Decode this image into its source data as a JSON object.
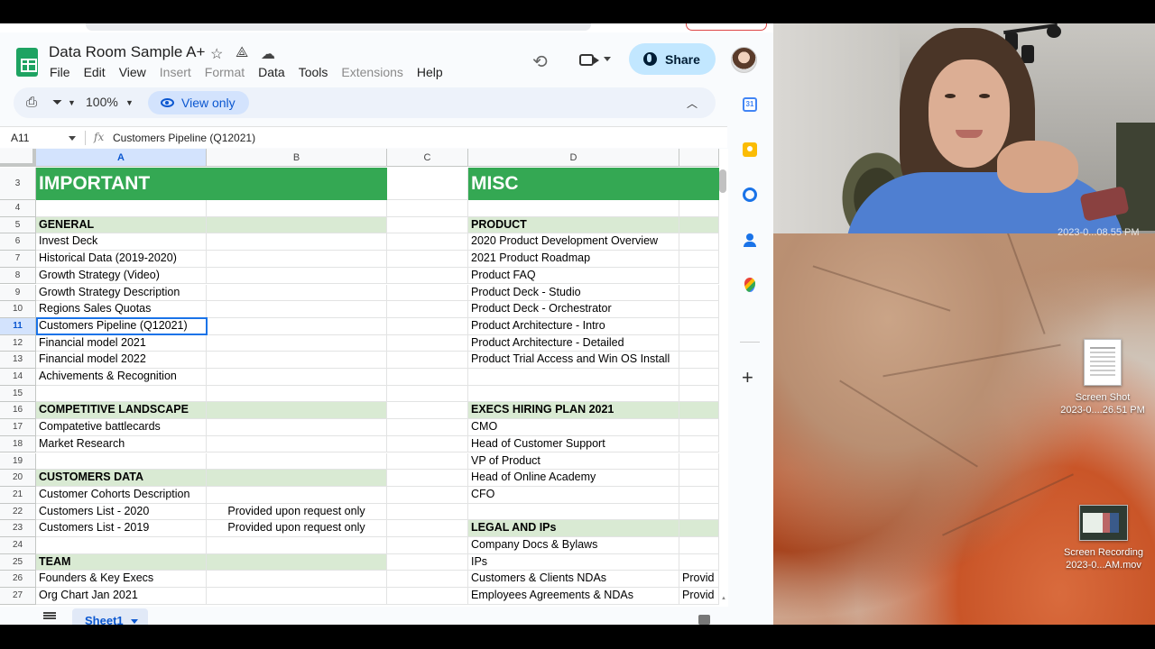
{
  "app": {
    "doc_title": "Data Room Sample A+",
    "menu": [
      {
        "label": "File",
        "enabled": true
      },
      {
        "label": "Edit",
        "enabled": true
      },
      {
        "label": "View",
        "enabled": true
      },
      {
        "label": "Insert",
        "enabled": false
      },
      {
        "label": "Format",
        "enabled": false
      },
      {
        "label": "Data",
        "enabled": true
      },
      {
        "label": "Tools",
        "enabled": true
      },
      {
        "label": "Extensions",
        "enabled": false
      },
      {
        "label": "Help",
        "enabled": true
      }
    ],
    "share_label": "Share"
  },
  "toolbar": {
    "zoom": "100%",
    "view_only_label": "View only"
  },
  "formula_bar": {
    "name_box": "A11",
    "fx": "fx",
    "value": "Customers Pipeline (Q12021)"
  },
  "grid": {
    "columns": [
      "A",
      "B",
      "C",
      "D",
      ""
    ],
    "selected_column": "A",
    "selected_row": "11",
    "rows": [
      {
        "num": "3",
        "a": "IMPORTANT",
        "b": "",
        "d": "MISC",
        "e": "",
        "style": "big"
      },
      {
        "num": "4",
        "a": "",
        "b": "",
        "d": "",
        "e": "",
        "style": ""
      },
      {
        "num": "5",
        "a": "GENERAL",
        "b": "",
        "d": "PRODUCT",
        "e": "",
        "style": "sec-both"
      },
      {
        "num": "6",
        "a": "Invest Deck",
        "b": "",
        "d": "2020 Product Development Overview",
        "e": "",
        "style": ""
      },
      {
        "num": "7",
        "a": "Historical Data (2019-2020)",
        "b": "",
        "d": "2021 Product Roadmap",
        "e": "",
        "style": ""
      },
      {
        "num": "8",
        "a": "Growth Strategy (Video)",
        "b": "",
        "d": "Product FAQ",
        "e": "",
        "style": ""
      },
      {
        "num": "9",
        "a": "Growth Strategy Description",
        "b": "",
        "d": "Product Deck - Studio",
        "e": "",
        "style": ""
      },
      {
        "num": "10",
        "a": "Regions Sales Quotas",
        "b": "",
        "d": "Product Deck - Orchestrator",
        "e": "",
        "style": ""
      },
      {
        "num": "11",
        "a": "Customers Pipeline (Q12021)",
        "b": "",
        "d": "Product Architecture - Intro",
        "e": "",
        "style": ""
      },
      {
        "num": "12",
        "a": "Financial model 2021",
        "b": "",
        "d": "Product Architecture - Detailed",
        "e": "",
        "style": ""
      },
      {
        "num": "13",
        "a": "Financial model 2022",
        "b": "",
        "d": "Product Trial Access and Win OS Install",
        "e": "",
        "style": ""
      },
      {
        "num": "14",
        "a": "Achivements & Recognition",
        "b": "",
        "d": "",
        "e": "",
        "style": ""
      },
      {
        "num": "15",
        "a": "",
        "b": "",
        "d": "",
        "e": "",
        "style": ""
      },
      {
        "num": "16",
        "a": "COMPETITIVE LANDSCAPE",
        "b": "",
        "d": "EXECS HIRING PLAN 2021",
        "e": "",
        "style": "sec-both"
      },
      {
        "num": "17",
        "a": "Compatetive battlecards",
        "b": "",
        "d": "CMO",
        "e": "",
        "style": ""
      },
      {
        "num": "18",
        "a": "Market Research",
        "b": "",
        "d": "Head of Customer Support",
        "e": "",
        "style": ""
      },
      {
        "num": "19",
        "a": "",
        "b": "",
        "d": "VP of Product",
        "e": "",
        "style": ""
      },
      {
        "num": "20",
        "a": "CUSTOMERS DATA",
        "b": "",
        "d": "Head of Online Academy",
        "e": "",
        "style": "sec-left"
      },
      {
        "num": "21",
        "a": "Customer Cohorts Description",
        "b": "",
        "d": "CFO",
        "e": "",
        "style": ""
      },
      {
        "num": "22",
        "a": "Customers List - 2020",
        "b": "Provided upon request only",
        "d": "",
        "e": "",
        "style": ""
      },
      {
        "num": "23",
        "a": "Customers List - 2019",
        "b": "Provided upon request only",
        "d": "LEGAL AND IPs",
        "e": "",
        "style": "sec-right"
      },
      {
        "num": "24",
        "a": "",
        "b": "",
        "d": "Company Docs & Bylaws",
        "e": "",
        "style": ""
      },
      {
        "num": "25",
        "a": "TEAM",
        "b": "",
        "d": "IPs",
        "e": "",
        "style": "sec-left"
      },
      {
        "num": "26",
        "a": "Founders & Key Execs",
        "b": "",
        "d": "Customers & Clients NDAs",
        "e": "Provid",
        "style": ""
      },
      {
        "num": "27",
        "a": "Org Chart Jan 2021",
        "b": "",
        "d": "Employees Agreements & NDAs",
        "e": "Provid",
        "style": ""
      }
    ]
  },
  "sheets": {
    "active_tab": "Sheet1"
  },
  "side_panel": {
    "calendar_day": "31"
  },
  "desktop": {
    "files": [
      {
        "line1": "Screen Shot",
        "line2": "2023-0....26.51 PM",
        "icon": "screenshot-file-icon"
      },
      {
        "line1": "Screen Recording",
        "line2": "2023-0...AM.mov",
        "icon": "video-file-icon"
      }
    ],
    "partial_timestamp": "2023-0...08.55 PM"
  },
  "colors": {
    "header_green": "#34a853",
    "section_green": "#d9ead3",
    "share_button": "#c2e7ff",
    "selection_blue": "#1a73e8"
  }
}
